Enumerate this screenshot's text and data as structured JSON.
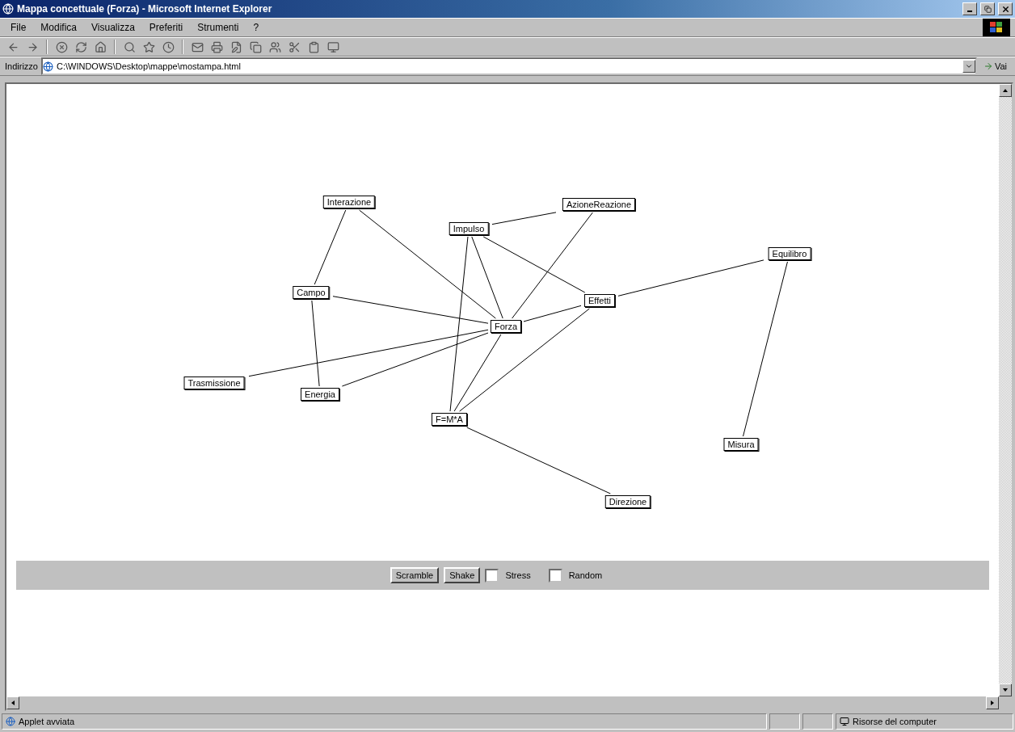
{
  "window": {
    "title": "Mappa concettuale (Forza) - Microsoft Internet Explorer"
  },
  "menu": [
    "File",
    "Modifica",
    "Visualizza",
    "Preferiti",
    "Strumenti",
    "?"
  ],
  "address_bar": {
    "label": "Indirizzo",
    "value": "C:\\WINDOWS\\Desktop\\mappe\\mostampa.html",
    "go": "Vai"
  },
  "concept_map": {
    "nodes": [
      {
        "label": "Interazione"
      },
      {
        "label": "AzioneReazione"
      },
      {
        "label": "Impulso"
      },
      {
        "label": "Equilibro"
      },
      {
        "label": "Campo"
      },
      {
        "label": "Effetti"
      },
      {
        "label": "Forza"
      },
      {
        "label": "Trasmissione"
      },
      {
        "label": "Energia"
      },
      {
        "label": "F=M*A"
      },
      {
        "label": "Misura"
      },
      {
        "label": "Direzione"
      }
    ]
  },
  "applet_controls": {
    "buttons": [
      "Scramble",
      "Shake"
    ],
    "checkboxes": [
      {
        "label": "Stress",
        "checked": false
      },
      {
        "label": "Random",
        "checked": false
      }
    ]
  },
  "status_bar": {
    "message": "Applet avviata",
    "zone": "Risorse del computer"
  }
}
